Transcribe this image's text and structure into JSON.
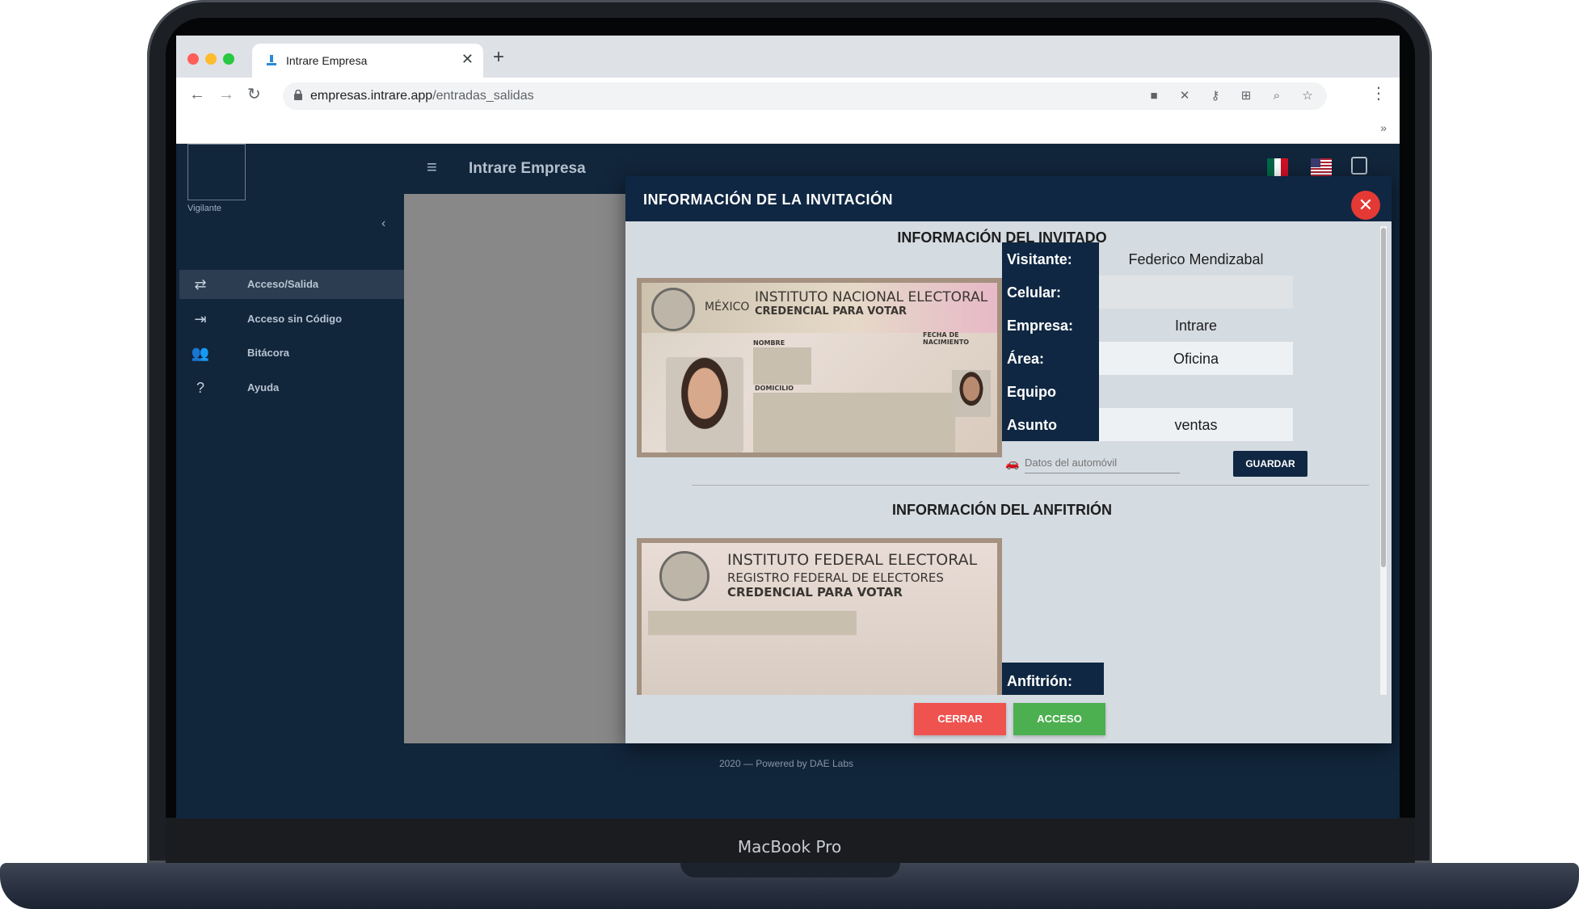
{
  "device": {
    "label": "MacBook Pro"
  },
  "browser": {
    "tab_title": "Intrare Empresa",
    "url_domain": "empresas.intrare.app",
    "url_path": "/entradas_salidas",
    "toolbar_icons": [
      "camera-icon",
      "notifications-off-icon",
      "key-icon",
      "translate-icon",
      "zoom-icon",
      "star-icon"
    ]
  },
  "sidebar": {
    "role": "Vigilante",
    "items": [
      {
        "label": "Acceso/Salida",
        "icon": "swap-icon",
        "active": true
      },
      {
        "label": "Acceso sin Código",
        "icon": "login-icon",
        "active": false
      },
      {
        "label": "Bitácora",
        "icon": "people-icon",
        "active": false
      },
      {
        "label": "Ayuda",
        "icon": "help-icon",
        "active": false
      }
    ]
  },
  "header": {
    "title": "Intrare Empresa"
  },
  "footer": {
    "text": "2020 — Powered by DAE Labs"
  },
  "modal": {
    "title": "INFORMACIÓN DE LA INVITACIÓN",
    "guest_section_title": "INFORMACIÓN DEL INVITADO",
    "host_section_title": "INFORMACIÓN DEL ANFITRIÓN",
    "guest_fields": [
      {
        "label": "Visitante:",
        "value": "Federico Mendizabal"
      },
      {
        "label": "Celular:",
        "value": ""
      },
      {
        "label": "Empresa:",
        "value": "Intrare"
      },
      {
        "label": "Área:",
        "value": "Oficina"
      },
      {
        "label": "Equipo",
        "value": ""
      },
      {
        "label": "Asunto",
        "value": "ventas"
      }
    ],
    "car_placeholder": "Datos del automóvil",
    "save_label": "GUARDAR",
    "host_label": "Anfitrión:",
    "close_label": "CERRAR",
    "access_label": "ACCESO",
    "guest_id": {
      "country": "MÉXICO",
      "line1": "INSTITUTO NACIONAL ELECTORAL",
      "line2": "CREDENCIAL PARA VOTAR",
      "name_label": "NOMBRE",
      "address_label": "DOMICILIO",
      "birth_label": "FECHA DE NACIMIENTO"
    },
    "host_id": {
      "line1": "INSTITUTO FEDERAL ELECTORAL",
      "line2": "REGISTRO FEDERAL DE ELECTORES",
      "line3": "CREDENCIAL PARA VOTAR"
    }
  },
  "colors": {
    "navy": "#0f2742",
    "sidebar": "#11253b",
    "close_red": "#e53935",
    "cerrar": "#ef5350",
    "acceso": "#4caf50"
  }
}
